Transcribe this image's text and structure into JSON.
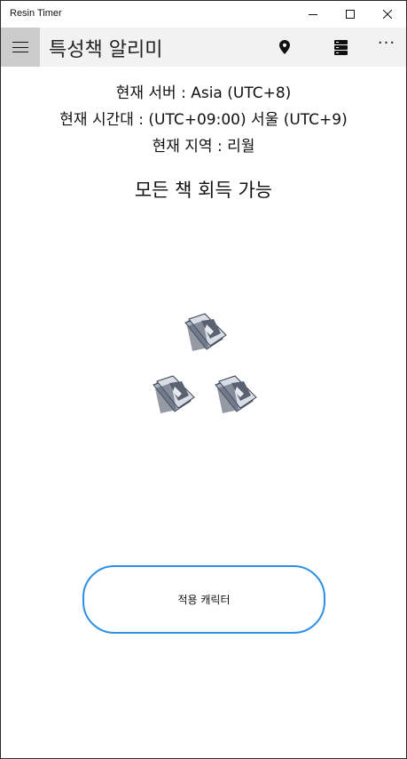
{
  "window": {
    "title": "Resin Timer"
  },
  "appbar": {
    "title": "특성책 알리미",
    "more_label": "···"
  },
  "info": {
    "server": "현재 서버 : Asia (UTC+8)",
    "timezone": "현재 시간대 : (UTC+09:00) 서울 (UTC+9)",
    "region": "현재 지역 : 리월"
  },
  "status": "모든 책 회득 가능",
  "apply_button": {
    "label": "적용 캐릭터"
  },
  "icons": {
    "hamburger": "hamburger-menu-icon",
    "location": "location-pin-icon",
    "server": "server-icon",
    "more": "more-ellipsis-icon",
    "books": [
      "talent-book-icon",
      "talent-book-icon",
      "talent-book-icon"
    ]
  },
  "colors": {
    "accent": "#2e8fe6",
    "appbar_bg": "#f2f2f2",
    "hamburger_bg": "#cccccc"
  }
}
